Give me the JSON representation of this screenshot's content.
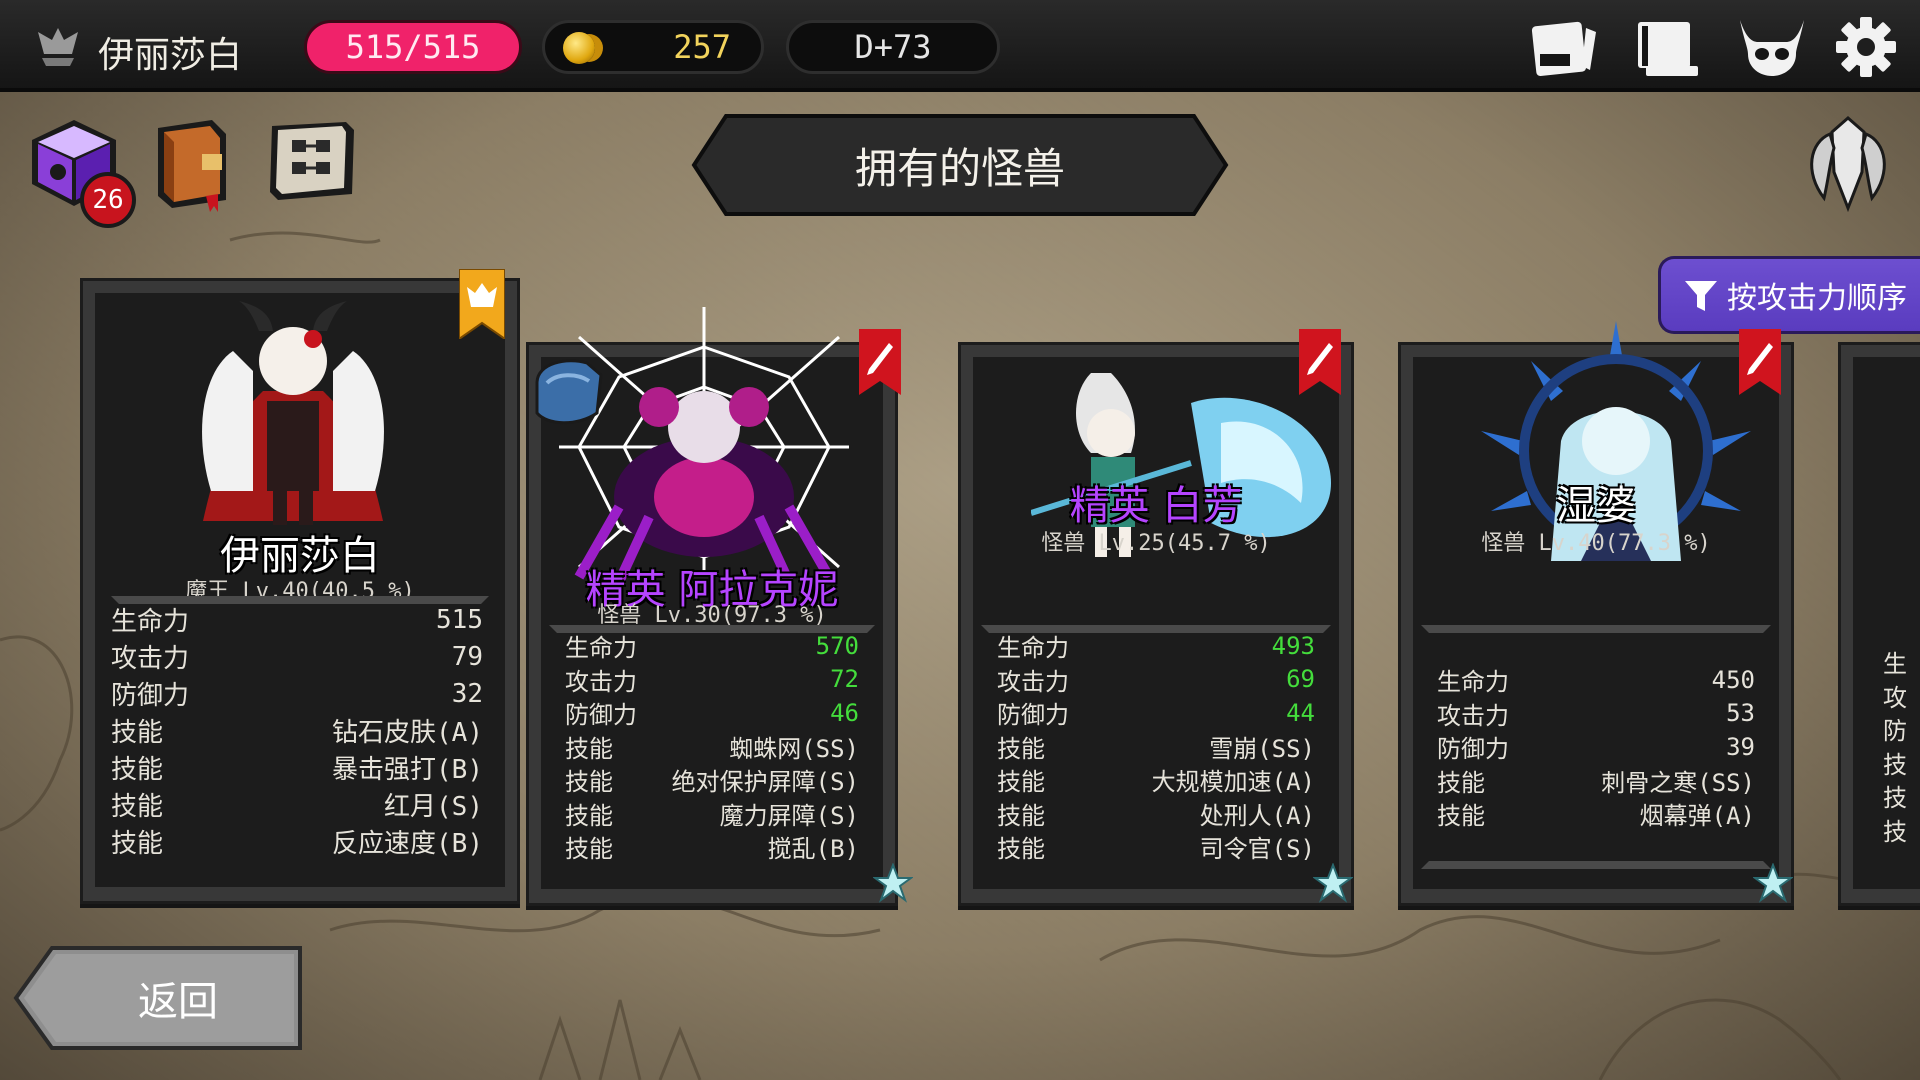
{
  "header": {
    "player_name": "伊丽莎白",
    "hp": "515/515",
    "gold": "257",
    "day": "D+73",
    "icons": [
      "player-crest-icon",
      "quest-card-icon",
      "journal-book-icon",
      "demon-skull-icon",
      "gear-icon"
    ]
  },
  "toolbar": {
    "inventory_badge": "26",
    "icons": [
      "magic-cube-icon",
      "spellbook-icon",
      "formation-scroll-icon",
      "winged-shield-icon"
    ]
  },
  "title": "拥有的怪兽",
  "sort_label": "按攻击力顺序",
  "back_label": "返回",
  "colors": {
    "hp_pill": "#f0226a",
    "gold_text": "#f2d35c",
    "elite_name": "#b544ff",
    "stat_highlight": "#44dd3c",
    "sort_button": "#5a3cbf",
    "card_bg": "#1c1c1c"
  },
  "cards": [
    {
      "name": "伊丽莎白",
      "rank": "魔王",
      "level": " Lv.40(40.5 %)",
      "tag": "demon-king-ribbon-icon",
      "stats": [
        {
          "label": "生命力",
          "value": "515"
        },
        {
          "label": "攻击力",
          "value": "79"
        },
        {
          "label": "防御力",
          "value": "32"
        },
        {
          "label": "技能",
          "value": "钻石皮肤(A)"
        },
        {
          "label": "技能",
          "value": "暴击强打(B)"
        },
        {
          "label": "技能",
          "value": "红月(S)"
        },
        {
          "label": "技能",
          "value": "反应速度(B)"
        }
      ]
    },
    {
      "name": "精英 阿拉克妮",
      "rank": "怪兽",
      "level": " Lv.30(97.3 %)",
      "tag": "edit-flag-icon",
      "stats": [
        {
          "label": "生命力",
          "value": "570"
        },
        {
          "label": "攻击力",
          "value": "72"
        },
        {
          "label": "防御力",
          "value": "46"
        },
        {
          "label": "技能",
          "value": "蜘蛛网(SS)"
        },
        {
          "label": "技能",
          "value": "绝对保护屏障(S)"
        },
        {
          "label": "技能",
          "value": "魔力屏障(S)"
        },
        {
          "label": "技能",
          "value": "搅乱(B)"
        }
      ]
    },
    {
      "name": "精英 白芳",
      "rank": "怪兽",
      "level": " Lv.25(45.7 %)",
      "tag": "edit-flag-icon",
      "stats": [
        {
          "label": "生命力",
          "value": "493"
        },
        {
          "label": "攻击力",
          "value": "69"
        },
        {
          "label": "防御力",
          "value": "44"
        },
        {
          "label": "技能",
          "value": "雪崩(SS)"
        },
        {
          "label": "技能",
          "value": "大规模加速(A)"
        },
        {
          "label": "技能",
          "value": "处刑人(A)"
        },
        {
          "label": "技能",
          "value": "司令官(S)"
        }
      ]
    },
    {
      "name": "湿婆",
      "rank": "怪兽",
      "level": " Lv.40(77.3 %)",
      "tag": "edit-flag-icon",
      "stats": [
        {
          "label": "生命力",
          "value": "450"
        },
        {
          "label": "攻击力",
          "value": "53"
        },
        {
          "label": "防御力",
          "value": "39"
        },
        {
          "label": "技能",
          "value": "刺骨之寒(SS)"
        },
        {
          "label": "技能",
          "value": "烟幕弹(A)"
        }
      ]
    },
    {
      "stats_partial": [
        "生",
        "攻",
        "防",
        "技",
        "技",
        "技"
      ]
    }
  ]
}
